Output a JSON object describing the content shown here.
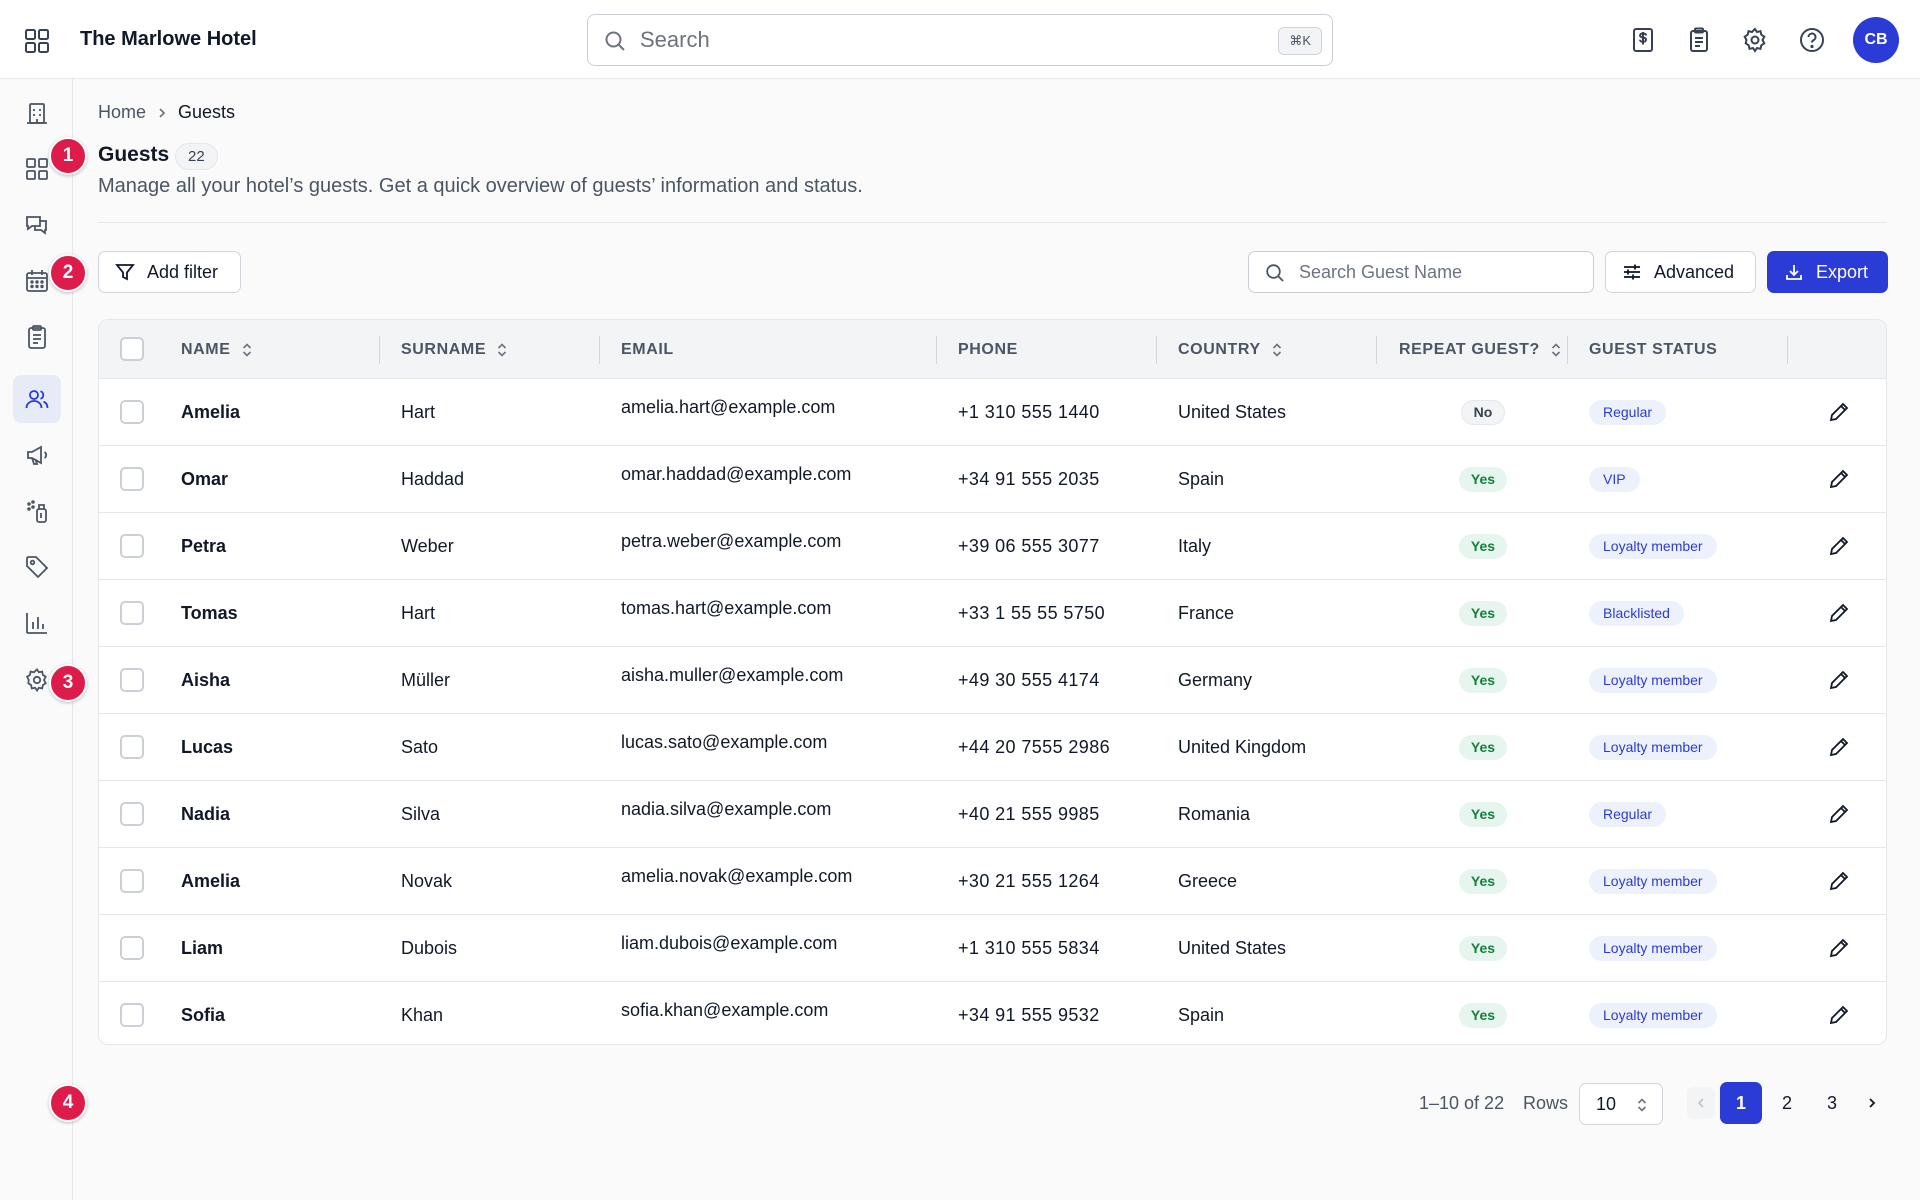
{
  "header": {
    "app_title": "The Marlowe Hotel",
    "search_placeholder": "Search",
    "search_shortcut": "⌘K",
    "icons": [
      "apps-grid-icon",
      "billing-icon",
      "clipboard-icon",
      "settings-icon",
      "help-icon"
    ],
    "avatar_initials": "CB"
  },
  "sidebar": {
    "items": [
      {
        "name": "building-icon",
        "active": false
      },
      {
        "name": "dashboard-icon",
        "active": false
      },
      {
        "name": "messages-icon",
        "active": false
      },
      {
        "name": "calendar-icon",
        "active": false
      },
      {
        "name": "clipboard-icon",
        "active": false
      },
      {
        "name": "users-icon",
        "active": true
      },
      {
        "name": "megaphone-icon",
        "active": false
      },
      {
        "name": "housekeeping-icon",
        "active": false
      },
      {
        "name": "tag-icon",
        "active": false
      },
      {
        "name": "chart-icon",
        "active": false
      },
      {
        "name": "settings-icon",
        "active": false
      }
    ]
  },
  "markers": [
    "1",
    "2",
    "3",
    "4"
  ],
  "breadcrumb": {
    "home": "Home",
    "current": "Guests"
  },
  "page": {
    "title": "Guests",
    "count": "22",
    "subtitle": "Manage all your hotel’s guests. Get a quick overview of guests’ information and status."
  },
  "toolbar": {
    "add_filter": "Add filter",
    "search_placeholder": "Search Guest Name",
    "advanced": "Advanced",
    "export": "Export"
  },
  "table": {
    "columns": [
      "NAME",
      "SURNAME",
      "EMAIL",
      "PHONE",
      "COUNTRY",
      "REPEAT GUEST?",
      "GUEST STATUS"
    ],
    "rows": [
      {
        "name": "Amelia",
        "surname": "Hart",
        "email": "amelia.hart@example.com",
        "phone": "+1 310 555 1440",
        "country": "United States",
        "repeat": "No",
        "status": "Regular"
      },
      {
        "name": "Omar",
        "surname": "Haddad",
        "email": "omar.haddad@example.com",
        "phone": "+34 91 555 2035",
        "country": "Spain",
        "repeat": "Yes",
        "status": "VIP"
      },
      {
        "name": "Petra",
        "surname": "Weber",
        "email": "petra.weber@example.com",
        "phone": "+39 06 555 3077",
        "country": "Italy",
        "repeat": "Yes",
        "status": "Loyalty member"
      },
      {
        "name": "Tomas",
        "surname": "Hart",
        "email": "tomas.hart@example.com",
        "phone": "+33 1 55 55 5750",
        "country": "France",
        "repeat": "Yes",
        "status": "Blacklisted"
      },
      {
        "name": "Aisha",
        "surname": "Müller",
        "email": "aisha.muller@example.com",
        "phone": "+49 30 555 4174",
        "country": "Germany",
        "repeat": "Yes",
        "status": "Loyalty member"
      },
      {
        "name": "Lucas",
        "surname": "Sato",
        "email": "lucas.sato@example.com",
        "phone": "+44 20 7555 2986",
        "country": "United Kingdom",
        "repeat": "Yes",
        "status": "Loyalty member"
      },
      {
        "name": "Nadia",
        "surname": "Silva",
        "email": "nadia.silva@example.com",
        "phone": "+40 21 555 9985",
        "country": "Romania",
        "repeat": "Yes",
        "status": "Regular"
      },
      {
        "name": "Amelia",
        "surname": "Novak",
        "email": "amelia.novak@example.com",
        "phone": "+30 21 555 1264",
        "country": "Greece",
        "repeat": "Yes",
        "status": "Loyalty member"
      },
      {
        "name": "Liam",
        "surname": "Dubois",
        "email": "liam.dubois@example.com",
        "phone": "+1 310 555 5834",
        "country": "United States",
        "repeat": "Yes",
        "status": "Loyalty member"
      },
      {
        "name": "Sofia",
        "surname": "Khan",
        "email": "sofia.khan@example.com",
        "phone": "+34 91 555 9532",
        "country": "Spain",
        "repeat": "Yes",
        "status": "Loyalty member"
      }
    ]
  },
  "pagination": {
    "range": "1–10 of 22",
    "rows_label": "Rows",
    "rows_value": "10",
    "pages": [
      "1",
      "2",
      "3"
    ],
    "current_page": "1"
  },
  "colors": {
    "primary": "#2b3bd6",
    "marker": "#dd1c4b",
    "yes_bg": "#e6f6ee",
    "yes_text": "#15803d",
    "status_bg": "#edf1fb"
  }
}
